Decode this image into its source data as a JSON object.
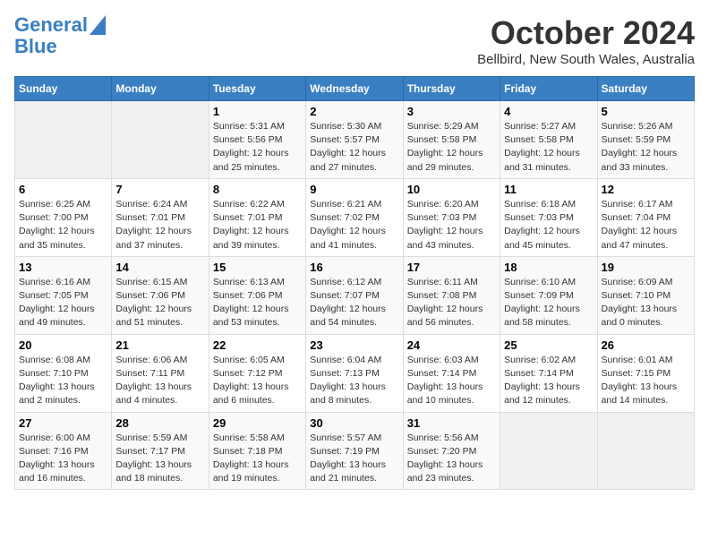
{
  "header": {
    "logo_line1": "General",
    "logo_line2": "Blue",
    "month": "October 2024",
    "location": "Bellbird, New South Wales, Australia"
  },
  "days_of_week": [
    "Sunday",
    "Monday",
    "Tuesday",
    "Wednesday",
    "Thursday",
    "Friday",
    "Saturday"
  ],
  "weeks": [
    [
      {
        "day": "",
        "info": ""
      },
      {
        "day": "",
        "info": ""
      },
      {
        "day": "1",
        "sunrise": "Sunrise: 5:31 AM",
        "sunset": "Sunset: 5:56 PM",
        "daylight": "Daylight: 12 hours and 25 minutes."
      },
      {
        "day": "2",
        "sunrise": "Sunrise: 5:30 AM",
        "sunset": "Sunset: 5:57 PM",
        "daylight": "Daylight: 12 hours and 27 minutes."
      },
      {
        "day": "3",
        "sunrise": "Sunrise: 5:29 AM",
        "sunset": "Sunset: 5:58 PM",
        "daylight": "Daylight: 12 hours and 29 minutes."
      },
      {
        "day": "4",
        "sunrise": "Sunrise: 5:27 AM",
        "sunset": "Sunset: 5:58 PM",
        "daylight": "Daylight: 12 hours and 31 minutes."
      },
      {
        "day": "5",
        "sunrise": "Sunrise: 5:26 AM",
        "sunset": "Sunset: 5:59 PM",
        "daylight": "Daylight: 12 hours and 33 minutes."
      }
    ],
    [
      {
        "day": "6",
        "sunrise": "Sunrise: 6:25 AM",
        "sunset": "Sunset: 7:00 PM",
        "daylight": "Daylight: 12 hours and 35 minutes."
      },
      {
        "day": "7",
        "sunrise": "Sunrise: 6:24 AM",
        "sunset": "Sunset: 7:01 PM",
        "daylight": "Daylight: 12 hours and 37 minutes."
      },
      {
        "day": "8",
        "sunrise": "Sunrise: 6:22 AM",
        "sunset": "Sunset: 7:01 PM",
        "daylight": "Daylight: 12 hours and 39 minutes."
      },
      {
        "day": "9",
        "sunrise": "Sunrise: 6:21 AM",
        "sunset": "Sunset: 7:02 PM",
        "daylight": "Daylight: 12 hours and 41 minutes."
      },
      {
        "day": "10",
        "sunrise": "Sunrise: 6:20 AM",
        "sunset": "Sunset: 7:03 PM",
        "daylight": "Daylight: 12 hours and 43 minutes."
      },
      {
        "day": "11",
        "sunrise": "Sunrise: 6:18 AM",
        "sunset": "Sunset: 7:03 PM",
        "daylight": "Daylight: 12 hours and 45 minutes."
      },
      {
        "day": "12",
        "sunrise": "Sunrise: 6:17 AM",
        "sunset": "Sunset: 7:04 PM",
        "daylight": "Daylight: 12 hours and 47 minutes."
      }
    ],
    [
      {
        "day": "13",
        "sunrise": "Sunrise: 6:16 AM",
        "sunset": "Sunset: 7:05 PM",
        "daylight": "Daylight: 12 hours and 49 minutes."
      },
      {
        "day": "14",
        "sunrise": "Sunrise: 6:15 AM",
        "sunset": "Sunset: 7:06 PM",
        "daylight": "Daylight: 12 hours and 51 minutes."
      },
      {
        "day": "15",
        "sunrise": "Sunrise: 6:13 AM",
        "sunset": "Sunset: 7:06 PM",
        "daylight": "Daylight: 12 hours and 53 minutes."
      },
      {
        "day": "16",
        "sunrise": "Sunrise: 6:12 AM",
        "sunset": "Sunset: 7:07 PM",
        "daylight": "Daylight: 12 hours and 54 minutes."
      },
      {
        "day": "17",
        "sunrise": "Sunrise: 6:11 AM",
        "sunset": "Sunset: 7:08 PM",
        "daylight": "Daylight: 12 hours and 56 minutes."
      },
      {
        "day": "18",
        "sunrise": "Sunrise: 6:10 AM",
        "sunset": "Sunset: 7:09 PM",
        "daylight": "Daylight: 12 hours and 58 minutes."
      },
      {
        "day": "19",
        "sunrise": "Sunrise: 6:09 AM",
        "sunset": "Sunset: 7:10 PM",
        "daylight": "Daylight: 13 hours and 0 minutes."
      }
    ],
    [
      {
        "day": "20",
        "sunrise": "Sunrise: 6:08 AM",
        "sunset": "Sunset: 7:10 PM",
        "daylight": "Daylight: 13 hours and 2 minutes."
      },
      {
        "day": "21",
        "sunrise": "Sunrise: 6:06 AM",
        "sunset": "Sunset: 7:11 PM",
        "daylight": "Daylight: 13 hours and 4 minutes."
      },
      {
        "day": "22",
        "sunrise": "Sunrise: 6:05 AM",
        "sunset": "Sunset: 7:12 PM",
        "daylight": "Daylight: 13 hours and 6 minutes."
      },
      {
        "day": "23",
        "sunrise": "Sunrise: 6:04 AM",
        "sunset": "Sunset: 7:13 PM",
        "daylight": "Daylight: 13 hours and 8 minutes."
      },
      {
        "day": "24",
        "sunrise": "Sunrise: 6:03 AM",
        "sunset": "Sunset: 7:14 PM",
        "daylight": "Daylight: 13 hours and 10 minutes."
      },
      {
        "day": "25",
        "sunrise": "Sunrise: 6:02 AM",
        "sunset": "Sunset: 7:14 PM",
        "daylight": "Daylight: 13 hours and 12 minutes."
      },
      {
        "day": "26",
        "sunrise": "Sunrise: 6:01 AM",
        "sunset": "Sunset: 7:15 PM",
        "daylight": "Daylight: 13 hours and 14 minutes."
      }
    ],
    [
      {
        "day": "27",
        "sunrise": "Sunrise: 6:00 AM",
        "sunset": "Sunset: 7:16 PM",
        "daylight": "Daylight: 13 hours and 16 minutes."
      },
      {
        "day": "28",
        "sunrise": "Sunrise: 5:59 AM",
        "sunset": "Sunset: 7:17 PM",
        "daylight": "Daylight: 13 hours and 18 minutes."
      },
      {
        "day": "29",
        "sunrise": "Sunrise: 5:58 AM",
        "sunset": "Sunset: 7:18 PM",
        "daylight": "Daylight: 13 hours and 19 minutes."
      },
      {
        "day": "30",
        "sunrise": "Sunrise: 5:57 AM",
        "sunset": "Sunset: 7:19 PM",
        "daylight": "Daylight: 13 hours and 21 minutes."
      },
      {
        "day": "31",
        "sunrise": "Sunrise: 5:56 AM",
        "sunset": "Sunset: 7:20 PM",
        "daylight": "Daylight: 13 hours and 23 minutes."
      },
      {
        "day": "",
        "info": ""
      },
      {
        "day": "",
        "info": ""
      }
    ]
  ]
}
